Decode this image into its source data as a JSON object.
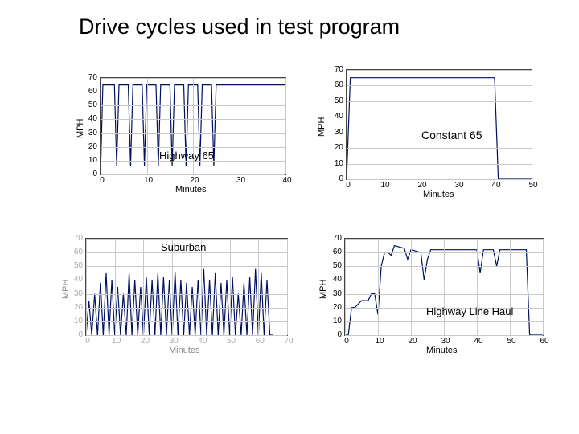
{
  "title": "Drive cycles used in test program",
  "chart_data": [
    {
      "type": "line",
      "title": "Highway 65",
      "xlabel": "Minutes",
      "ylabel": "MPH",
      "xlim": [
        0,
        40
      ],
      "ylim": [
        0,
        70
      ],
      "x_ticks": [
        0,
        10,
        20,
        30,
        40
      ],
      "y_ticks": [
        0,
        10,
        20,
        30,
        40,
        50,
        60,
        70
      ],
      "series": [
        {
          "name": "Highway 65",
          "x": [
            0,
            0.5,
            1,
            2,
            3,
            3.5,
            4,
            5,
            6,
            6.5,
            7,
            8,
            9,
            9.5,
            10,
            11,
            12,
            12.5,
            13,
            14,
            15,
            15.5,
            16,
            17,
            18,
            18.5,
            19,
            20,
            21,
            21.5,
            22,
            23,
            24,
            24.5,
            25,
            26,
            40,
            40.5
          ],
          "y": [
            0,
            65,
            65,
            65,
            65,
            6,
            65,
            65,
            65,
            6,
            65,
            65,
            65,
            6,
            65,
            65,
            65,
            6,
            65,
            65,
            65,
            6,
            65,
            65,
            65,
            6,
            65,
            65,
            65,
            6,
            65,
            65,
            65,
            6,
            65,
            65,
            65,
            0
          ]
        }
      ]
    },
    {
      "type": "line",
      "title": "Constant 65",
      "xlabel": "Minutes",
      "ylabel": "MPH",
      "xlim": [
        0,
        50
      ],
      "ylim": [
        0,
        70
      ],
      "x_ticks": [
        0,
        10,
        20,
        30,
        40,
        50
      ],
      "y_ticks": [
        0,
        10,
        20,
        30,
        40,
        50,
        60,
        70
      ],
      "series": [
        {
          "name": "Constant 65",
          "x": [
            0,
            1,
            40,
            41,
            50
          ],
          "y": [
            0,
            65,
            65,
            0,
            0
          ]
        }
      ]
    },
    {
      "type": "line",
      "title": "Suburban",
      "xlabel": "Minutes",
      "ylabel": "MPH",
      "xlim": [
        0,
        70
      ],
      "ylim": [
        0,
        70
      ],
      "x_ticks": [
        0,
        10,
        20,
        30,
        40,
        50,
        60,
        70
      ],
      "y_ticks": [
        0,
        10,
        20,
        30,
        40,
        50,
        60,
        70
      ],
      "series": [
        {
          "name": "Suburban",
          "x": [
            0,
            1,
            2,
            3,
            4,
            5,
            6,
            7,
            8,
            9,
            10,
            11,
            12,
            13,
            14,
            15,
            16,
            17,
            18,
            19,
            20,
            21,
            22,
            23,
            24,
            25,
            26,
            27,
            28,
            29,
            30,
            31,
            32,
            33,
            34,
            35,
            36,
            37,
            38,
            39,
            40,
            41,
            42,
            43,
            44,
            45,
            46,
            47,
            48,
            49,
            50,
            51,
            52,
            53,
            54,
            55,
            56,
            57,
            58,
            59,
            60,
            61,
            62,
            63,
            64,
            65
          ],
          "y": [
            0,
            25,
            0,
            30,
            0,
            38,
            0,
            45,
            0,
            40,
            0,
            35,
            0,
            30,
            0,
            45,
            0,
            40,
            0,
            35,
            0,
            42,
            0,
            40,
            0,
            45,
            0,
            42,
            0,
            40,
            0,
            46,
            0,
            40,
            0,
            38,
            0,
            35,
            0,
            40,
            0,
            48,
            0,
            40,
            0,
            45,
            0,
            38,
            0,
            40,
            0,
            42,
            0,
            30,
            0,
            38,
            0,
            42,
            0,
            48,
            0,
            45,
            0,
            40,
            0,
            0
          ]
        }
      ]
    },
    {
      "type": "line",
      "title": "Highway Line Haul",
      "xlabel": "Minutes",
      "ylabel": "MPH",
      "xlim": [
        0,
        60
      ],
      "ylim": [
        0,
        70
      ],
      "x_ticks": [
        0,
        10,
        20,
        30,
        40,
        50,
        60
      ],
      "y_ticks": [
        0,
        10,
        20,
        30,
        40,
        50,
        60,
        70
      ],
      "series": [
        {
          "name": "Highway Line Haul",
          "x": [
            0,
            1,
            2,
            3,
            5,
            7,
            8,
            9,
            10,
            11,
            12,
            13,
            14,
            15,
            18,
            19,
            20,
            23,
            24,
            25,
            26,
            40,
            41,
            42,
            45,
            46,
            47,
            55,
            56,
            60
          ],
          "y": [
            0,
            0,
            20,
            20,
            25,
            25,
            30,
            30,
            15,
            50,
            60,
            60,
            58,
            65,
            63,
            55,
            62,
            60,
            40,
            55,
            62,
            62,
            45,
            62,
            62,
            50,
            62,
            62,
            0,
            0
          ]
        }
      ]
    }
  ],
  "charts": {
    "0": {
      "label": "Highway 65",
      "xlabel": "Minutes",
      "ylabel": "MPH"
    },
    "1": {
      "label": "Constant 65",
      "xlabel": "Minutes",
      "ylabel": "MPH"
    },
    "2": {
      "label": "Suburban",
      "xlabel": "Minutes",
      "ylabel": "MPH"
    },
    "3": {
      "label": "Highway Line Haul",
      "xlabel": "Minutes",
      "ylabel": "MPH"
    }
  }
}
